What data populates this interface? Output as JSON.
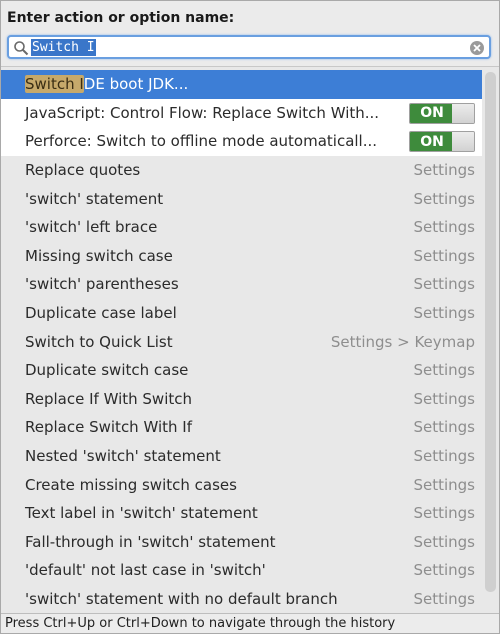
{
  "header": {
    "title": "Enter action or option name:"
  },
  "search": {
    "value": "Switch I",
    "icon": "search-icon",
    "clear_icon": "clear-icon"
  },
  "rows": [
    {
      "label_match": "Switch I",
      "label_rest": "DE boot JDK...",
      "right": "",
      "toggle": null,
      "selected": true,
      "white": false
    },
    {
      "label_match": "",
      "label_rest": "JavaScript: Control Flow: Replace Switch With...",
      "right": "",
      "toggle": "ON",
      "selected": false,
      "white": true
    },
    {
      "label_match": "",
      "label_rest": "Perforce: Switch to offline mode automaticall...",
      "right": "",
      "toggle": "ON",
      "selected": false,
      "white": true
    },
    {
      "label_match": "",
      "label_rest": "Replace quotes",
      "right": "Settings",
      "toggle": null,
      "selected": false,
      "white": false
    },
    {
      "label_match": "",
      "label_rest": "'switch' statement",
      "right": "Settings",
      "toggle": null,
      "selected": false,
      "white": false
    },
    {
      "label_match": "",
      "label_rest": "'switch' left brace",
      "right": "Settings",
      "toggle": null,
      "selected": false,
      "white": false
    },
    {
      "label_match": "",
      "label_rest": "Missing switch case",
      "right": "Settings",
      "toggle": null,
      "selected": false,
      "white": false
    },
    {
      "label_match": "",
      "label_rest": "'switch' parentheses",
      "right": "Settings",
      "toggle": null,
      "selected": false,
      "white": false
    },
    {
      "label_match": "",
      "label_rest": "Duplicate case label",
      "right": "Settings",
      "toggle": null,
      "selected": false,
      "white": false
    },
    {
      "label_match": "",
      "label_rest": "Switch to Quick List",
      "right": "Settings > Keymap",
      "toggle": null,
      "selected": false,
      "white": false
    },
    {
      "label_match": "",
      "label_rest": "Duplicate switch case",
      "right": "Settings",
      "toggle": null,
      "selected": false,
      "white": false
    },
    {
      "label_match": "",
      "label_rest": "Replace If With Switch",
      "right": "Settings",
      "toggle": null,
      "selected": false,
      "white": false
    },
    {
      "label_match": "",
      "label_rest": "Replace Switch With If",
      "right": "Settings",
      "toggle": null,
      "selected": false,
      "white": false
    },
    {
      "label_match": "",
      "label_rest": "Nested 'switch' statement",
      "right": "Settings",
      "toggle": null,
      "selected": false,
      "white": false
    },
    {
      "label_match": "",
      "label_rest": "Create missing switch cases",
      "right": "Settings",
      "toggle": null,
      "selected": false,
      "white": false
    },
    {
      "label_match": "",
      "label_rest": "Text label in 'switch' statement",
      "right": "Settings",
      "toggle": null,
      "selected": false,
      "white": false
    },
    {
      "label_match": "",
      "label_rest": "Fall-through in 'switch' statement",
      "right": "Settings",
      "toggle": null,
      "selected": false,
      "white": false
    },
    {
      "label_match": "",
      "label_rest": "'default' not last case in 'switch'",
      "right": "Settings",
      "toggle": null,
      "selected": false,
      "white": false
    },
    {
      "label_match": "",
      "label_rest": "'switch' statement with no default branch",
      "right": "Settings",
      "toggle": null,
      "selected": false,
      "white": false
    }
  ],
  "status": {
    "text": "Press Ctrl+Up or Ctrl+Down to navigate through the history"
  },
  "colors": {
    "selection": "#3d7ed6",
    "match_highlight": "#c6a96b",
    "toggle_on": "#3e8b3c",
    "secondary_text": "#8e8e8e"
  }
}
